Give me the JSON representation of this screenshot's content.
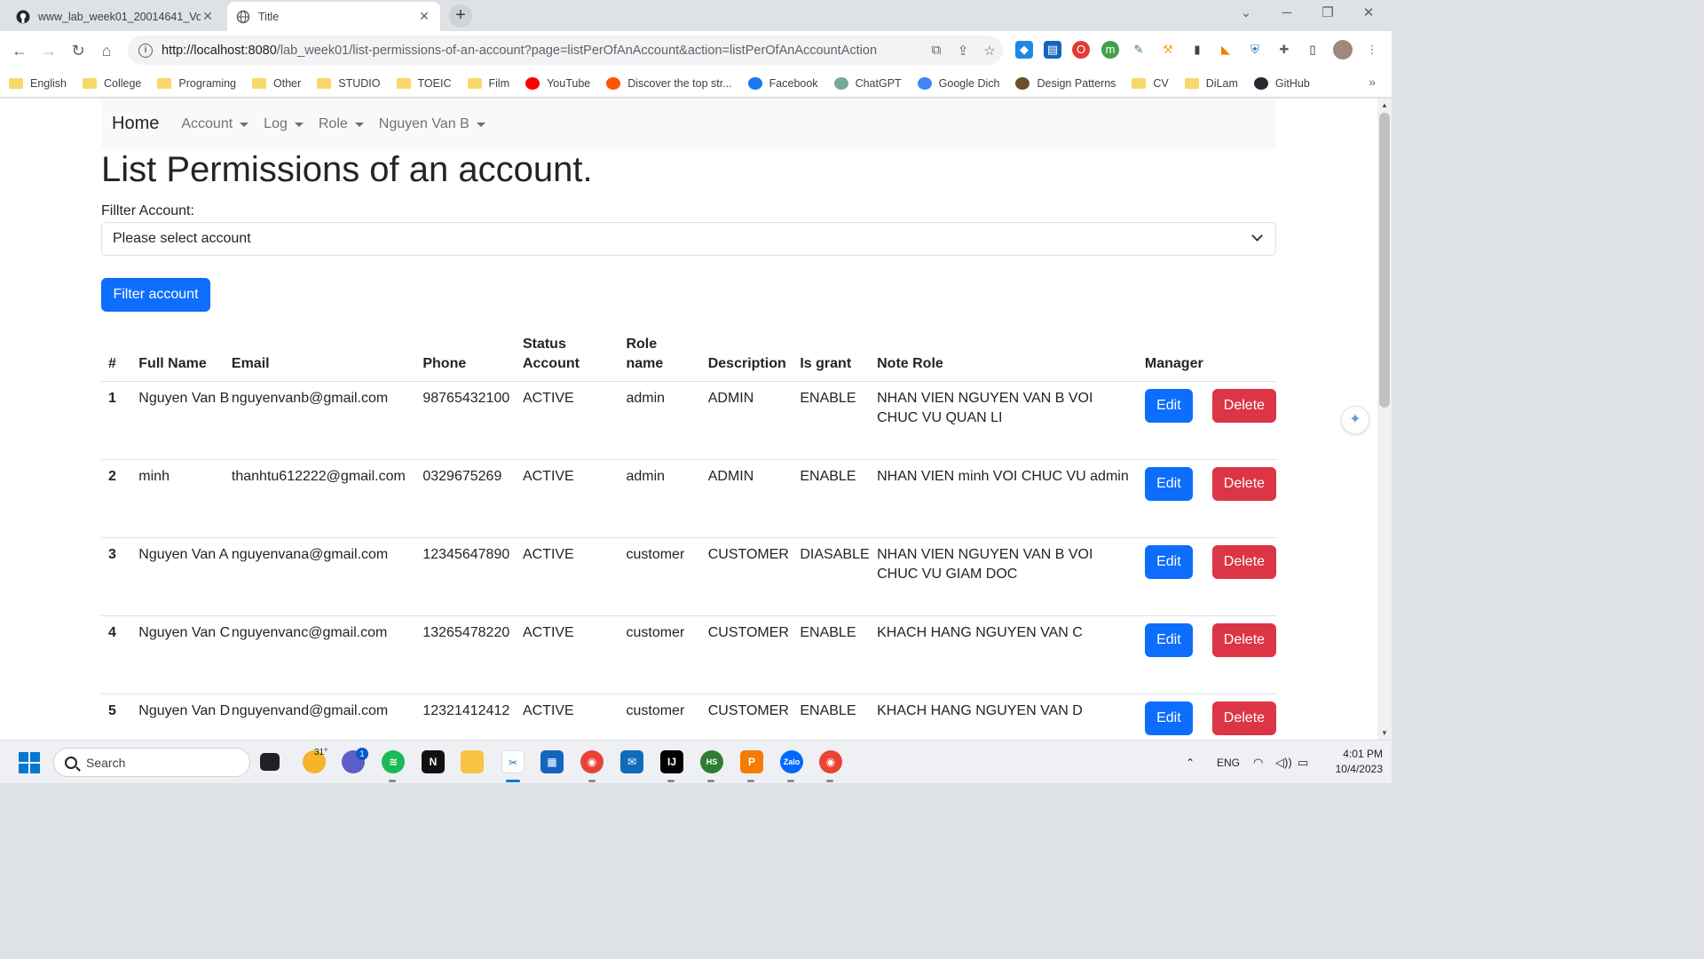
{
  "browser": {
    "tabs": [
      {
        "title": "www_lab_week01_20014641_Vo"
      },
      {
        "title": "Title"
      }
    ],
    "url_host": "http://localhost:8080",
    "url_path": "/lab_week01/list-permissions-of-an-account?page=listPerOfAnAccount&action=listPerOfAnAccountAction",
    "bookmarks": [
      {
        "label": "English",
        "icon": "folder-icon"
      },
      {
        "label": "College",
        "icon": "folder-icon"
      },
      {
        "label": "Programing",
        "icon": "folder-icon"
      },
      {
        "label": "Other",
        "icon": "folder-icon"
      },
      {
        "label": "STUDIO",
        "icon": "folder-icon"
      },
      {
        "label": "TOEIC",
        "icon": "folder-icon"
      },
      {
        "label": "Film",
        "icon": "folder-icon"
      },
      {
        "label": "YouTube",
        "icon": "youtube-icon"
      },
      {
        "label": "Discover the top str...",
        "icon": "soundcloud-icon"
      },
      {
        "label": "Facebook",
        "icon": "facebook-icon"
      },
      {
        "label": "ChatGPT",
        "icon": "chatgpt-icon"
      },
      {
        "label": "Google Dich",
        "icon": "google-translate-icon"
      },
      {
        "label": "Design Patterns",
        "icon": "refactoring-guru-icon"
      },
      {
        "label": "CV",
        "icon": "folder-icon"
      },
      {
        "label": "DiLam",
        "icon": "folder-icon"
      },
      {
        "label": "GitHub",
        "icon": "github-icon"
      }
    ]
  },
  "navbar": {
    "brand": "Home",
    "items": [
      "Account",
      "Log",
      "Role",
      "Nguyen Van B"
    ]
  },
  "page": {
    "title": "List Permissions of an account.",
    "filter_label": "Fillter Account:",
    "select_value": "Please select account",
    "filter_button": "Filter account"
  },
  "table": {
    "headers": {
      "num": "#",
      "full_name": "Full Name",
      "email": "Email",
      "phone": "Phone",
      "status_1": "Status",
      "status_2": "Account",
      "role_1": "Role",
      "role_2": "name",
      "description": "Description",
      "is_grant": "Is grant",
      "note_role": "Note Role",
      "manager": "Manager"
    },
    "edit_label": "Edit",
    "delete_label": "Delete",
    "rows": [
      {
        "num": "1",
        "full_name": "Nguyen Van B",
        "email": "nguyenvanb@gmail.com",
        "phone": "98765432100",
        "status": "ACTIVE",
        "role": "admin",
        "description": "ADMIN",
        "is_grant": "ENABLE",
        "note": "NHAN VIEN NGUYEN VAN B VOI CHUC VU QUAN LI"
      },
      {
        "num": "2",
        "full_name": "minh",
        "email": "thanhtu612222@gmail.com",
        "phone": "0329675269",
        "status": "ACTIVE",
        "role": "admin",
        "description": "ADMIN",
        "is_grant": "ENABLE",
        "note": "NHAN VIEN minh VOI CHUC VU admin"
      },
      {
        "num": "3",
        "full_name": "Nguyen Van A",
        "email": "nguyenvana@gmail.com",
        "phone": "12345647890",
        "status": "ACTIVE",
        "role": "customer",
        "description": "CUSTOMER",
        "is_grant": "DIASABLE",
        "note": "NHAN VIEN NGUYEN VAN B VOI CHUC VU GIAM DOC"
      },
      {
        "num": "4",
        "full_name": "Nguyen Van C",
        "email": "nguyenvanc@gmail.com",
        "phone": "13265478220",
        "status": "ACTIVE",
        "role": "customer",
        "description": "CUSTOMER",
        "is_grant": "ENABLE",
        "note": "KHACH HANG NGUYEN VAN C"
      },
      {
        "num": "5",
        "full_name": "Nguyen Van D",
        "email": "nguyenvand@gmail.com",
        "phone": "12321412412",
        "status": "ACTIVE",
        "role": "customer",
        "description": "CUSTOMER",
        "is_grant": "ENABLE",
        "note": "KHACH HANG NGUYEN VAN D"
      }
    ]
  },
  "taskbar": {
    "search_placeholder": "Search",
    "weather_temp": "31°",
    "teams_badge": "1",
    "language": "ENG",
    "time": "4:01 PM",
    "date": "10/4/2023"
  },
  "colors": {
    "primary": "#0d6efd",
    "danger": "#dc3545",
    "navbar_bg": "#f8f9fa"
  }
}
